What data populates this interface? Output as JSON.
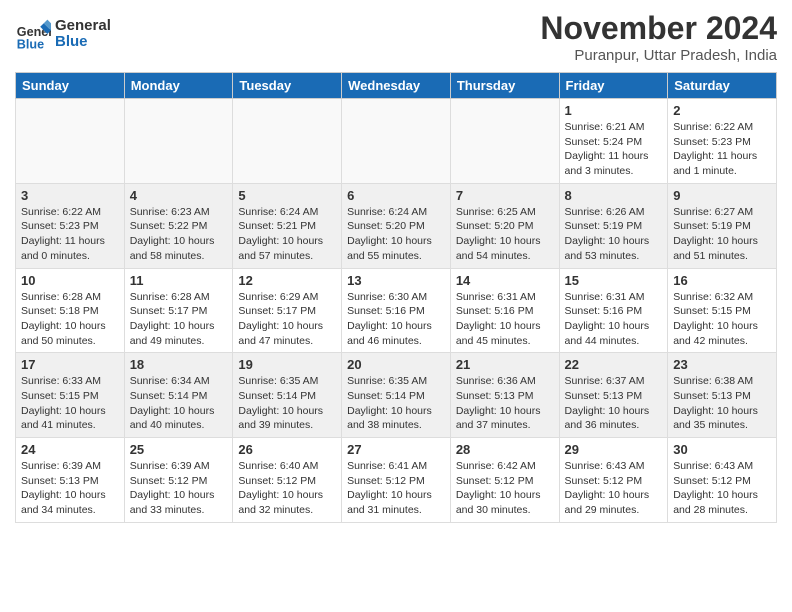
{
  "header": {
    "logo_line1": "General",
    "logo_line2": "Blue",
    "month_title": "November 2024",
    "subtitle": "Puranpur, Uttar Pradesh, India"
  },
  "columns": [
    "Sunday",
    "Monday",
    "Tuesday",
    "Wednesday",
    "Thursday",
    "Friday",
    "Saturday"
  ],
  "weeks": [
    {
      "days": [
        {
          "num": "",
          "info": ""
        },
        {
          "num": "",
          "info": ""
        },
        {
          "num": "",
          "info": ""
        },
        {
          "num": "",
          "info": ""
        },
        {
          "num": "",
          "info": ""
        },
        {
          "num": "1",
          "info": "Sunrise: 6:21 AM\nSunset: 5:24 PM\nDaylight: 11 hours\nand 3 minutes."
        },
        {
          "num": "2",
          "info": "Sunrise: 6:22 AM\nSunset: 5:23 PM\nDaylight: 11 hours\nand 1 minute."
        }
      ]
    },
    {
      "days": [
        {
          "num": "3",
          "info": "Sunrise: 6:22 AM\nSunset: 5:23 PM\nDaylight: 11 hours\nand 0 minutes."
        },
        {
          "num": "4",
          "info": "Sunrise: 6:23 AM\nSunset: 5:22 PM\nDaylight: 10 hours\nand 58 minutes."
        },
        {
          "num": "5",
          "info": "Sunrise: 6:24 AM\nSunset: 5:21 PM\nDaylight: 10 hours\nand 57 minutes."
        },
        {
          "num": "6",
          "info": "Sunrise: 6:24 AM\nSunset: 5:20 PM\nDaylight: 10 hours\nand 55 minutes."
        },
        {
          "num": "7",
          "info": "Sunrise: 6:25 AM\nSunset: 5:20 PM\nDaylight: 10 hours\nand 54 minutes."
        },
        {
          "num": "8",
          "info": "Sunrise: 6:26 AM\nSunset: 5:19 PM\nDaylight: 10 hours\nand 53 minutes."
        },
        {
          "num": "9",
          "info": "Sunrise: 6:27 AM\nSunset: 5:19 PM\nDaylight: 10 hours\nand 51 minutes."
        }
      ]
    },
    {
      "days": [
        {
          "num": "10",
          "info": "Sunrise: 6:28 AM\nSunset: 5:18 PM\nDaylight: 10 hours\nand 50 minutes."
        },
        {
          "num": "11",
          "info": "Sunrise: 6:28 AM\nSunset: 5:17 PM\nDaylight: 10 hours\nand 49 minutes."
        },
        {
          "num": "12",
          "info": "Sunrise: 6:29 AM\nSunset: 5:17 PM\nDaylight: 10 hours\nand 47 minutes."
        },
        {
          "num": "13",
          "info": "Sunrise: 6:30 AM\nSunset: 5:16 PM\nDaylight: 10 hours\nand 46 minutes."
        },
        {
          "num": "14",
          "info": "Sunrise: 6:31 AM\nSunset: 5:16 PM\nDaylight: 10 hours\nand 45 minutes."
        },
        {
          "num": "15",
          "info": "Sunrise: 6:31 AM\nSunset: 5:16 PM\nDaylight: 10 hours\nand 44 minutes."
        },
        {
          "num": "16",
          "info": "Sunrise: 6:32 AM\nSunset: 5:15 PM\nDaylight: 10 hours\nand 42 minutes."
        }
      ]
    },
    {
      "days": [
        {
          "num": "17",
          "info": "Sunrise: 6:33 AM\nSunset: 5:15 PM\nDaylight: 10 hours\nand 41 minutes."
        },
        {
          "num": "18",
          "info": "Sunrise: 6:34 AM\nSunset: 5:14 PM\nDaylight: 10 hours\nand 40 minutes."
        },
        {
          "num": "19",
          "info": "Sunrise: 6:35 AM\nSunset: 5:14 PM\nDaylight: 10 hours\nand 39 minutes."
        },
        {
          "num": "20",
          "info": "Sunrise: 6:35 AM\nSunset: 5:14 PM\nDaylight: 10 hours\nand 38 minutes."
        },
        {
          "num": "21",
          "info": "Sunrise: 6:36 AM\nSunset: 5:13 PM\nDaylight: 10 hours\nand 37 minutes."
        },
        {
          "num": "22",
          "info": "Sunrise: 6:37 AM\nSunset: 5:13 PM\nDaylight: 10 hours\nand 36 minutes."
        },
        {
          "num": "23",
          "info": "Sunrise: 6:38 AM\nSunset: 5:13 PM\nDaylight: 10 hours\nand 35 minutes."
        }
      ]
    },
    {
      "days": [
        {
          "num": "24",
          "info": "Sunrise: 6:39 AM\nSunset: 5:13 PM\nDaylight: 10 hours\nand 34 minutes."
        },
        {
          "num": "25",
          "info": "Sunrise: 6:39 AM\nSunset: 5:12 PM\nDaylight: 10 hours\nand 33 minutes."
        },
        {
          "num": "26",
          "info": "Sunrise: 6:40 AM\nSunset: 5:12 PM\nDaylight: 10 hours\nand 32 minutes."
        },
        {
          "num": "27",
          "info": "Sunrise: 6:41 AM\nSunset: 5:12 PM\nDaylight: 10 hours\nand 31 minutes."
        },
        {
          "num": "28",
          "info": "Sunrise: 6:42 AM\nSunset: 5:12 PM\nDaylight: 10 hours\nand 30 minutes."
        },
        {
          "num": "29",
          "info": "Sunrise: 6:43 AM\nSunset: 5:12 PM\nDaylight: 10 hours\nand 29 minutes."
        },
        {
          "num": "30",
          "info": "Sunrise: 6:43 AM\nSunset: 5:12 PM\nDaylight: 10 hours\nand 28 minutes."
        }
      ]
    }
  ]
}
